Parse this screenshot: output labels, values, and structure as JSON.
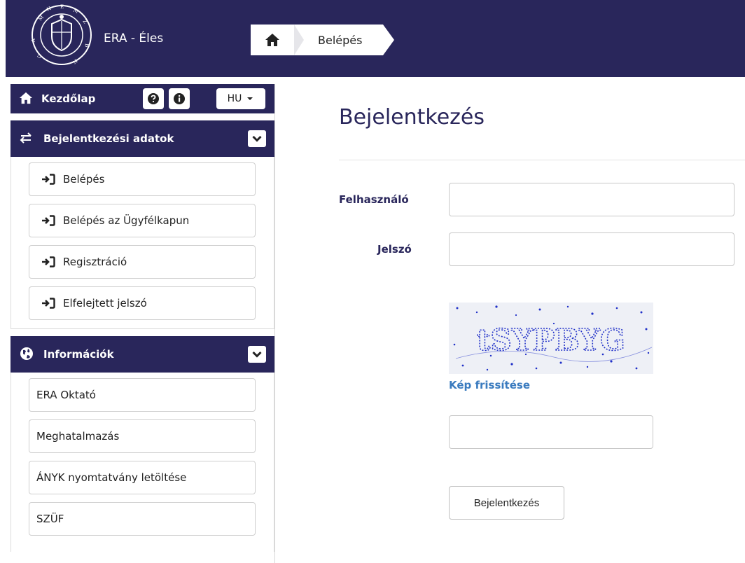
{
  "header": {
    "app_title": "ERA - Éles",
    "breadcrumb": {
      "current": "Belépés"
    }
  },
  "sidebar": {
    "home_panel": {
      "label": "Kezdőlap",
      "lang": "HU"
    },
    "login_panel": {
      "label": "Bejelentkezési adatok",
      "items": [
        {
          "label": "Belépés"
        },
        {
          "label": "Belépés az Ügyfélkapun"
        },
        {
          "label": "Regisztráció"
        },
        {
          "label": "Elfelejtett jelszó"
        }
      ]
    },
    "info_panel": {
      "label": "Információk",
      "items": [
        {
          "label": "ERA Oktató"
        },
        {
          "label": "Meghatalmazás"
        },
        {
          "label": "ÁNYK nyomtatvány letöltése"
        },
        {
          "label": "SZÜF"
        }
      ]
    }
  },
  "main": {
    "title": "Bejelentkezés",
    "username_label": "Felhasználó",
    "username_value": "",
    "password_label": "Jelszó",
    "password_value": "",
    "captcha_text": "tSYPBYG",
    "refresh_link": "Kép frissítése",
    "captcha_value": "",
    "submit_label": "Bejelentkezés"
  },
  "colors": {
    "brand": "#29265b",
    "link": "#3a7bbf",
    "captcha": "#2030c8"
  }
}
